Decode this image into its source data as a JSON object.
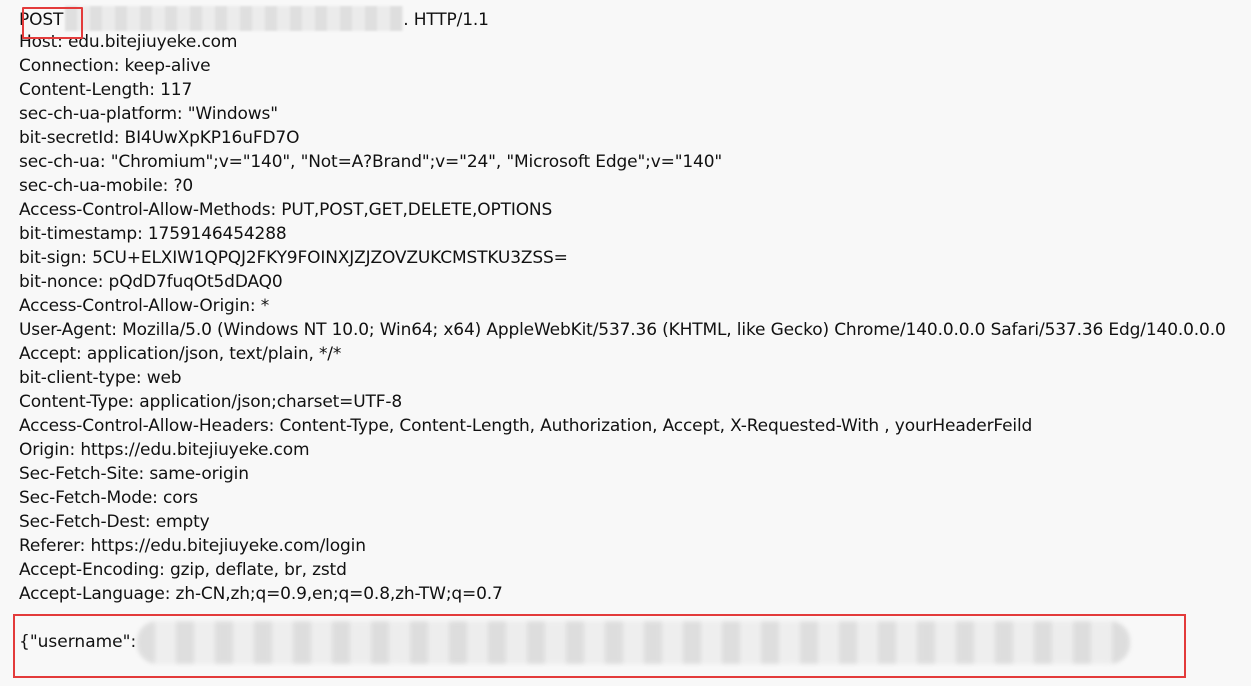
{
  "request": {
    "method": "POST",
    "protocol": ". HTTP/1.1",
    "headers": [
      "Host: edu.bitejiuyeke.com",
      "Connection: keep-alive",
      "Content-Length: 117",
      "sec-ch-ua-platform: \"Windows\"",
      "bit-secretId: BI4UwXpKP16uFD7O",
      "sec-ch-ua: \"Chromium\";v=\"140\", \"Not=A?Brand\";v=\"24\", \"Microsoft Edge\";v=\"140\"",
      "sec-ch-ua-mobile: ?0",
      "Access-Control-Allow-Methods: PUT,POST,GET,DELETE,OPTIONS",
      "bit-timestamp: 1759146454288",
      "bit-sign: 5CU+ELXIW1QPQJ2FKY9FOINXJZJZOVZUKCMSTKU3ZSS=",
      "bit-nonce: pQdD7fuqOt5dDAQ0",
      "Access-Control-Allow-Origin: *",
      "User-Agent: Mozilla/5.0 (Windows NT 10.0; Win64; x64) AppleWebKit/537.36 (KHTML, like Gecko) Chrome/140.0.0.0 Safari/537.36 Edg/140.0.0.0",
      "Accept: application/json, text/plain, */*",
      "bit-client-type: web",
      "Content-Type: application/json;charset=UTF-8",
      "Access-Control-Allow-Headers: Content-Type, Content-Length, Authorization, Accept, X-Requested-With , yourHeaderFeild",
      "Origin: https://edu.bitejiuyeke.com",
      "Sec-Fetch-Site: same-origin",
      "Sec-Fetch-Mode: cors",
      "Sec-Fetch-Dest: empty",
      "Referer: https://edu.bitejiuyeke.com/login",
      "Accept-Encoding: gzip, deflate, br, zstd",
      "Accept-Language: zh-CN,zh;q=0.9,en;q=0.8,zh-TW;q=0.7"
    ],
    "body_prefix": "{\"username\":"
  },
  "colors": {
    "highlight": "#e33b3b",
    "background": "#f8f8f8",
    "text": "#111111"
  }
}
